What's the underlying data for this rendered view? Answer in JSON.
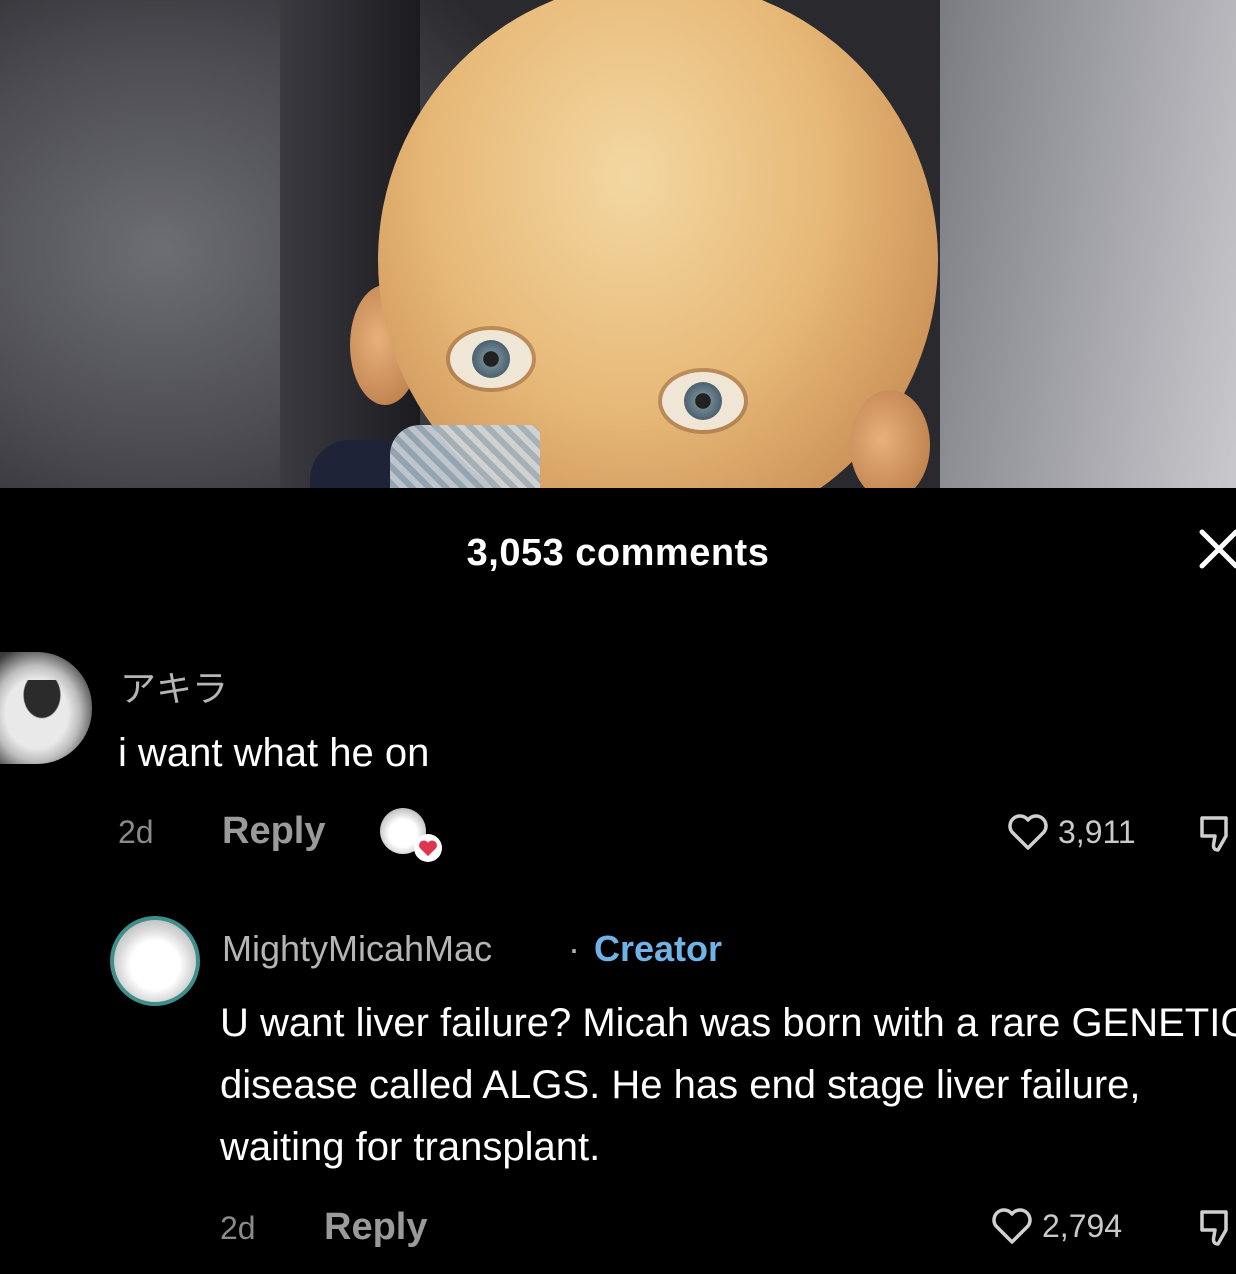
{
  "comments_header": {
    "count_label": "3,053 comments"
  },
  "comments": [
    {
      "username": "アキラ",
      "text": "i want what he on",
      "age": "2d",
      "reply_label": "Reply",
      "likes": "3,911",
      "creator_liked": true
    },
    {
      "username": "MightyMicahMac",
      "badge_separator": "·",
      "badge": "Creator",
      "text": "U want liver failure? Micah was born with a rare GENETIC disease called ALGS. He has end stage liver failure, waiting for transplant.",
      "age": "2d",
      "reply_label": "Reply",
      "likes": "2,794"
    }
  ],
  "colors": {
    "background": "#000000",
    "creator_badge": "#6fb3e7",
    "heart_red": "#e0344f"
  },
  "icons": [
    "close-icon",
    "heart-outline-icon",
    "dislike-icon",
    "creator-liked-heart-icon"
  ]
}
